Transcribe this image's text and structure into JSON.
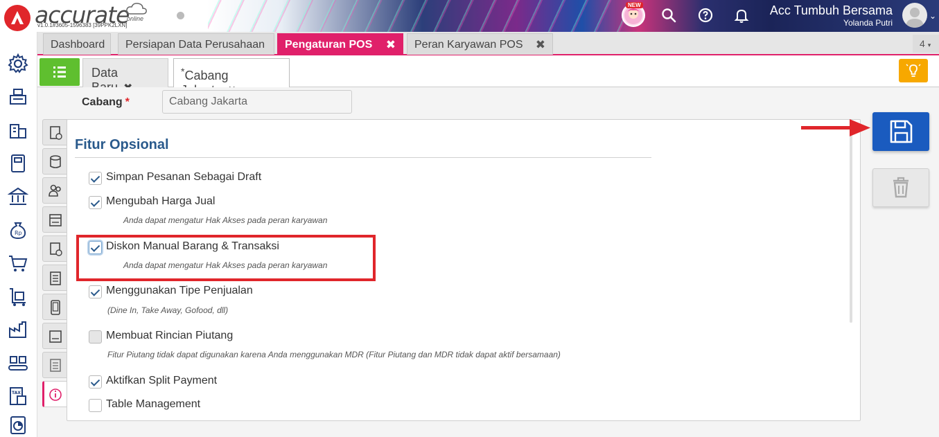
{
  "header": {
    "logo_text": "accurate",
    "logo_sub": "online",
    "version": "v1.0.1#3605-1596383 [39PPK2LXN]",
    "new_badge": "NEW",
    "company": "Acc Tumbuh Bersama",
    "user": "Yolanda Putri"
  },
  "tabs": [
    {
      "label": "Dashboard"
    },
    {
      "label": "Persiapan Data Perusahaan"
    },
    {
      "label": "Pengaturan POS"
    },
    {
      "label": "Peran Karyawan POS"
    }
  ],
  "tab_count": "4",
  "subtabs": [
    {
      "label": "Data Baru"
    },
    {
      "label": "Cabang Jakarta",
      "modified_marker": "*"
    }
  ],
  "form": {
    "cabang_label": "Cabang",
    "required_mark": "*",
    "cabang_value": "Cabang Jakarta",
    "section_title": "Fitur Opsional"
  },
  "options": [
    {
      "label": "Simpan Pesanan Sebagai Draft",
      "checked": true
    },
    {
      "label": "Mengubah Harga Jual",
      "checked": true,
      "hint": "Anda dapat mengatur Hak Akses pada peran karyawan"
    },
    {
      "label": "Diskon Manual Barang & Transaksi",
      "checked": true,
      "hint": "Anda dapat mengatur Hak Akses pada peran karyawan"
    },
    {
      "label": "Menggunakan Tipe Penjualan",
      "checked": true,
      "hint": "(Dine In, Take Away, Gofood, dll)"
    },
    {
      "label": "Membuat Rincian Piutang",
      "checked": false,
      "disabled": true,
      "hint": "Fitur Piutang tidak dapat digunakan karena Anda menggunakan MDR (Fitur Piutang dan MDR tidak dapat aktif bersamaan)"
    },
    {
      "label": "Aktifkan Split Payment",
      "checked": true
    },
    {
      "label": "Table Management",
      "checked": false
    }
  ],
  "colors": {
    "accent": "#e0206a",
    "primary": "#1a5bbf",
    "highlight": "#e0262b",
    "title": "#2a5a8c"
  }
}
